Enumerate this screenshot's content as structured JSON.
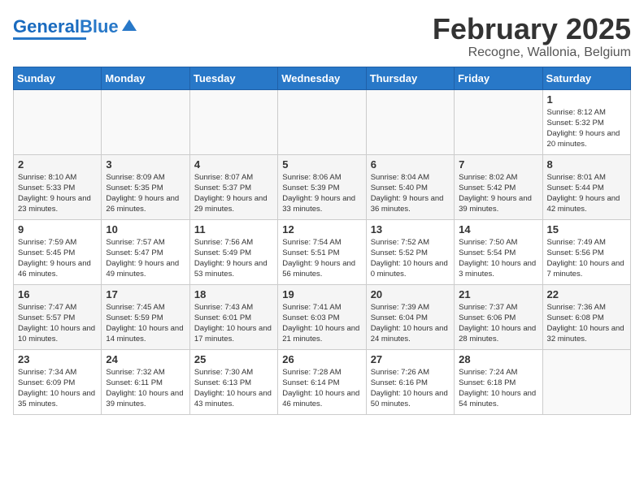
{
  "header": {
    "logo_line1": "General",
    "logo_line2": "Blue",
    "month": "February 2025",
    "location": "Recogne, Wallonia, Belgium"
  },
  "weekdays": [
    "Sunday",
    "Monday",
    "Tuesday",
    "Wednesday",
    "Thursday",
    "Friday",
    "Saturday"
  ],
  "weeks": [
    [
      {
        "day": "",
        "info": ""
      },
      {
        "day": "",
        "info": ""
      },
      {
        "day": "",
        "info": ""
      },
      {
        "day": "",
        "info": ""
      },
      {
        "day": "",
        "info": ""
      },
      {
        "day": "",
        "info": ""
      },
      {
        "day": "1",
        "info": "Sunrise: 8:12 AM\nSunset: 5:32 PM\nDaylight: 9 hours and 20 minutes."
      }
    ],
    [
      {
        "day": "2",
        "info": "Sunrise: 8:10 AM\nSunset: 5:33 PM\nDaylight: 9 hours and 23 minutes."
      },
      {
        "day": "3",
        "info": "Sunrise: 8:09 AM\nSunset: 5:35 PM\nDaylight: 9 hours and 26 minutes."
      },
      {
        "day": "4",
        "info": "Sunrise: 8:07 AM\nSunset: 5:37 PM\nDaylight: 9 hours and 29 minutes."
      },
      {
        "day": "5",
        "info": "Sunrise: 8:06 AM\nSunset: 5:39 PM\nDaylight: 9 hours and 33 minutes."
      },
      {
        "day": "6",
        "info": "Sunrise: 8:04 AM\nSunset: 5:40 PM\nDaylight: 9 hours and 36 minutes."
      },
      {
        "day": "7",
        "info": "Sunrise: 8:02 AM\nSunset: 5:42 PM\nDaylight: 9 hours and 39 minutes."
      },
      {
        "day": "8",
        "info": "Sunrise: 8:01 AM\nSunset: 5:44 PM\nDaylight: 9 hours and 42 minutes."
      }
    ],
    [
      {
        "day": "9",
        "info": "Sunrise: 7:59 AM\nSunset: 5:45 PM\nDaylight: 9 hours and 46 minutes."
      },
      {
        "day": "10",
        "info": "Sunrise: 7:57 AM\nSunset: 5:47 PM\nDaylight: 9 hours and 49 minutes."
      },
      {
        "day": "11",
        "info": "Sunrise: 7:56 AM\nSunset: 5:49 PM\nDaylight: 9 hours and 53 minutes."
      },
      {
        "day": "12",
        "info": "Sunrise: 7:54 AM\nSunset: 5:51 PM\nDaylight: 9 hours and 56 minutes."
      },
      {
        "day": "13",
        "info": "Sunrise: 7:52 AM\nSunset: 5:52 PM\nDaylight: 10 hours and 0 minutes."
      },
      {
        "day": "14",
        "info": "Sunrise: 7:50 AM\nSunset: 5:54 PM\nDaylight: 10 hours and 3 minutes."
      },
      {
        "day": "15",
        "info": "Sunrise: 7:49 AM\nSunset: 5:56 PM\nDaylight: 10 hours and 7 minutes."
      }
    ],
    [
      {
        "day": "16",
        "info": "Sunrise: 7:47 AM\nSunset: 5:57 PM\nDaylight: 10 hours and 10 minutes."
      },
      {
        "day": "17",
        "info": "Sunrise: 7:45 AM\nSunset: 5:59 PM\nDaylight: 10 hours and 14 minutes."
      },
      {
        "day": "18",
        "info": "Sunrise: 7:43 AM\nSunset: 6:01 PM\nDaylight: 10 hours and 17 minutes."
      },
      {
        "day": "19",
        "info": "Sunrise: 7:41 AM\nSunset: 6:03 PM\nDaylight: 10 hours and 21 minutes."
      },
      {
        "day": "20",
        "info": "Sunrise: 7:39 AM\nSunset: 6:04 PM\nDaylight: 10 hours and 24 minutes."
      },
      {
        "day": "21",
        "info": "Sunrise: 7:37 AM\nSunset: 6:06 PM\nDaylight: 10 hours and 28 minutes."
      },
      {
        "day": "22",
        "info": "Sunrise: 7:36 AM\nSunset: 6:08 PM\nDaylight: 10 hours and 32 minutes."
      }
    ],
    [
      {
        "day": "23",
        "info": "Sunrise: 7:34 AM\nSunset: 6:09 PM\nDaylight: 10 hours and 35 minutes."
      },
      {
        "day": "24",
        "info": "Sunrise: 7:32 AM\nSunset: 6:11 PM\nDaylight: 10 hours and 39 minutes."
      },
      {
        "day": "25",
        "info": "Sunrise: 7:30 AM\nSunset: 6:13 PM\nDaylight: 10 hours and 43 minutes."
      },
      {
        "day": "26",
        "info": "Sunrise: 7:28 AM\nSunset: 6:14 PM\nDaylight: 10 hours and 46 minutes."
      },
      {
        "day": "27",
        "info": "Sunrise: 7:26 AM\nSunset: 6:16 PM\nDaylight: 10 hours and 50 minutes."
      },
      {
        "day": "28",
        "info": "Sunrise: 7:24 AM\nSunset: 6:18 PM\nDaylight: 10 hours and 54 minutes."
      },
      {
        "day": "",
        "info": ""
      }
    ]
  ]
}
